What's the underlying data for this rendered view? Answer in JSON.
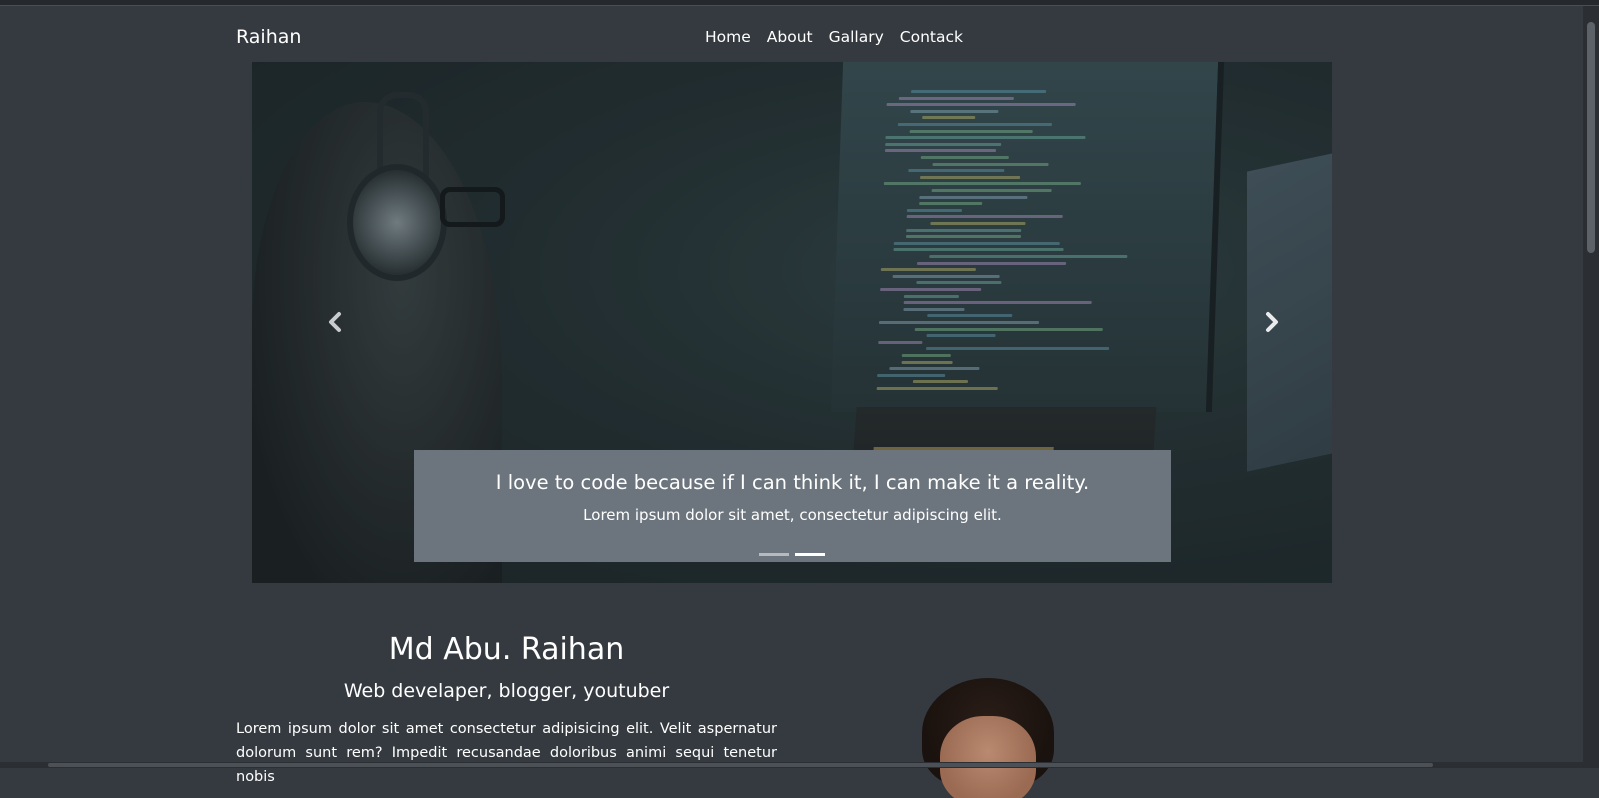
{
  "navbar": {
    "brand": "Raihan",
    "links": [
      "Home",
      "About",
      "Gallary",
      "Contack"
    ]
  },
  "carousel": {
    "caption_title": "I love to code because if I can think it, I can make it a reality.",
    "caption_text": "Lorem ipsum dolor sit amet, consectetur adipiscing elit.",
    "prev_icon": "chevron-left-icon",
    "next_icon": "chevron-right-icon",
    "slide_count": 2,
    "active_slide": 2
  },
  "profile": {
    "name": "Md Abu. Raihan",
    "role": "Web develaper, blogger, youtuber",
    "bio": "Lorem ipsum dolor sit amet consectetur adipisicing elit. Velit aspernatur dolorum sunt rem? Impedit recusandae doloribus animi sequi tenetur nobis"
  },
  "colors": {
    "page_background": "#343a40",
    "caption_background": "#6c757d",
    "text": "#ffffff"
  }
}
